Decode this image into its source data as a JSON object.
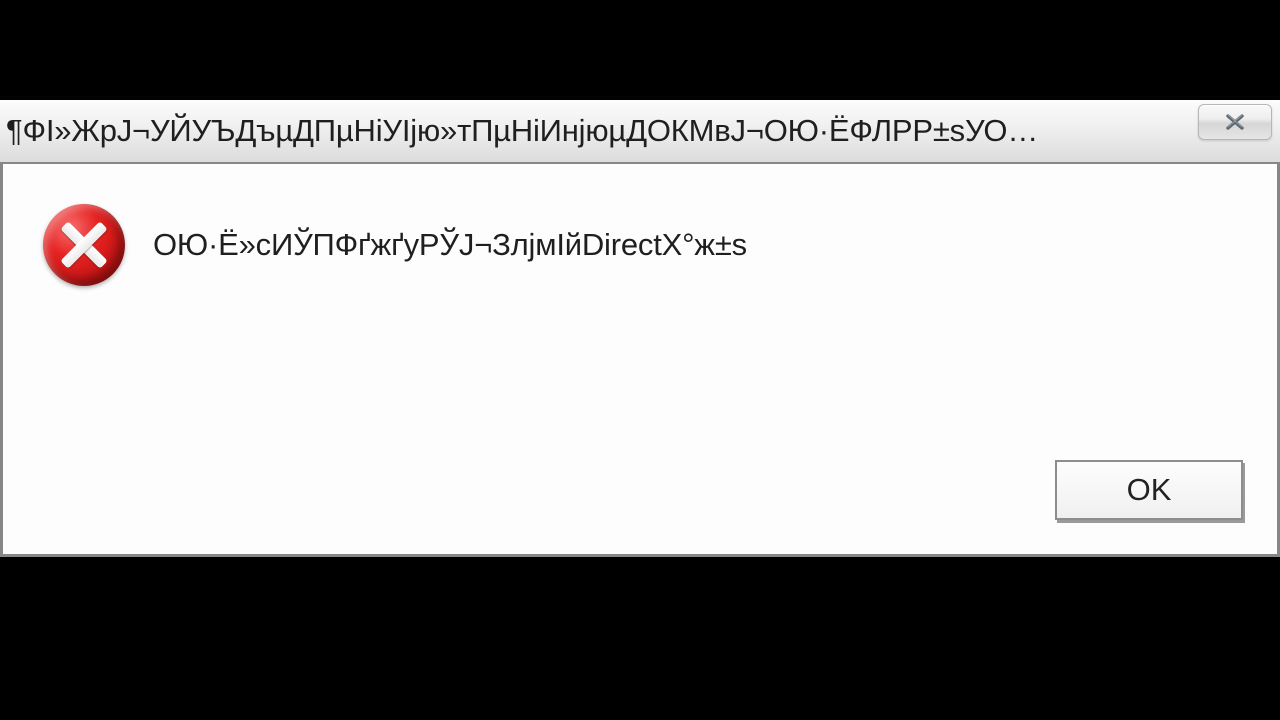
{
  "dialog": {
    "title": "¶ФІ»ЖрЈ¬УЙУЪДъµДПµНіУІјю»тПµНіИнјюµДОКМвЈ¬ОЮ·ЁФЛРР±sУО…",
    "message": "ОЮ·Ё»сИЎПФґжґуРЎЈ¬ЗлјмІйDirectX°ж±s",
    "close_tooltip": "Close",
    "ok_label": "OK"
  }
}
